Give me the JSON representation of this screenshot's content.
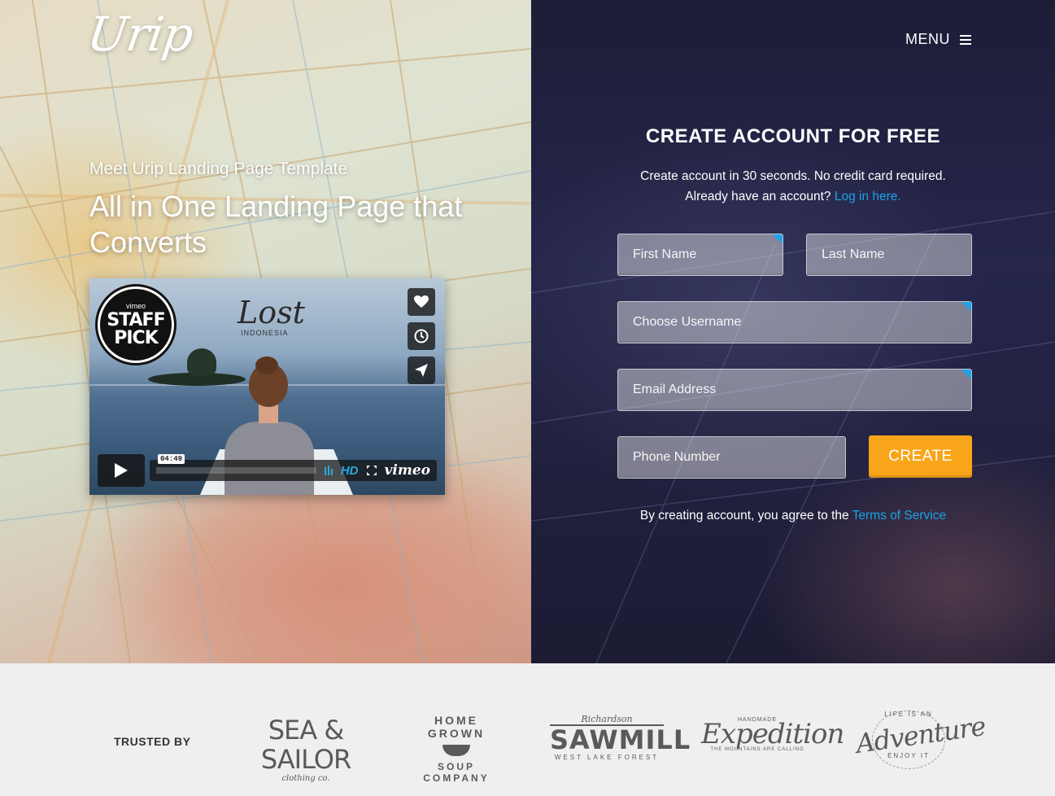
{
  "brand": {
    "logo": "Urip"
  },
  "nav": {
    "menu_label": "MENU",
    "menu_icon": "hamburger-icon"
  },
  "hero": {
    "subtitle": "Meet Urip Landing Page Template",
    "headline": "All in One Landing Page that Converts"
  },
  "video": {
    "staff_pick": {
      "vimeo": "vimeo",
      "line1": "STAFF",
      "line2": "PICK"
    },
    "title": "Lost",
    "title_sub": "INDONESIA",
    "side_icons": [
      "heart-icon",
      "clock-icon",
      "send-icon"
    ],
    "timecode": "04:49",
    "progress": 0.0,
    "hd_label": "HD",
    "provider": "vimeo"
  },
  "form": {
    "title": "CREATE ACCOUNT FOR FREE",
    "desc_line1": "Create account in 30 seconds. No credit card required.",
    "desc_line2_prefix": "Already have an account?",
    "login_link": "Log in here.",
    "fields": {
      "first_name": "First Name",
      "last_name": "Last Name",
      "username": "Choose Username",
      "email": "Email Address",
      "phone": "Phone Number"
    },
    "submit_label": "CREATE",
    "terms_prefix": "By creating account, you agree to the",
    "terms_link": "Terms of Service",
    "accent_color": "#1aa3e8",
    "button_color": "#f9a51a"
  },
  "trusted": {
    "label": "TRUSTED BY",
    "logos": [
      {
        "name": "SEA & SAILOR",
        "sub": "clothing co."
      },
      {
        "name": "HOME GROWN",
        "sub": "SOUP COMPANY"
      },
      {
        "top": "Richardson",
        "name": "SAWMILL",
        "sub": "WEST LAKE FOREST"
      },
      {
        "top": "HANDMADE",
        "name": "Expedition",
        "sub": "THE MOUNTAINS ARE CALLING"
      },
      {
        "top": "LIFE IS AN",
        "name": "Adventure",
        "sub": "ENJOY IT"
      }
    ]
  }
}
